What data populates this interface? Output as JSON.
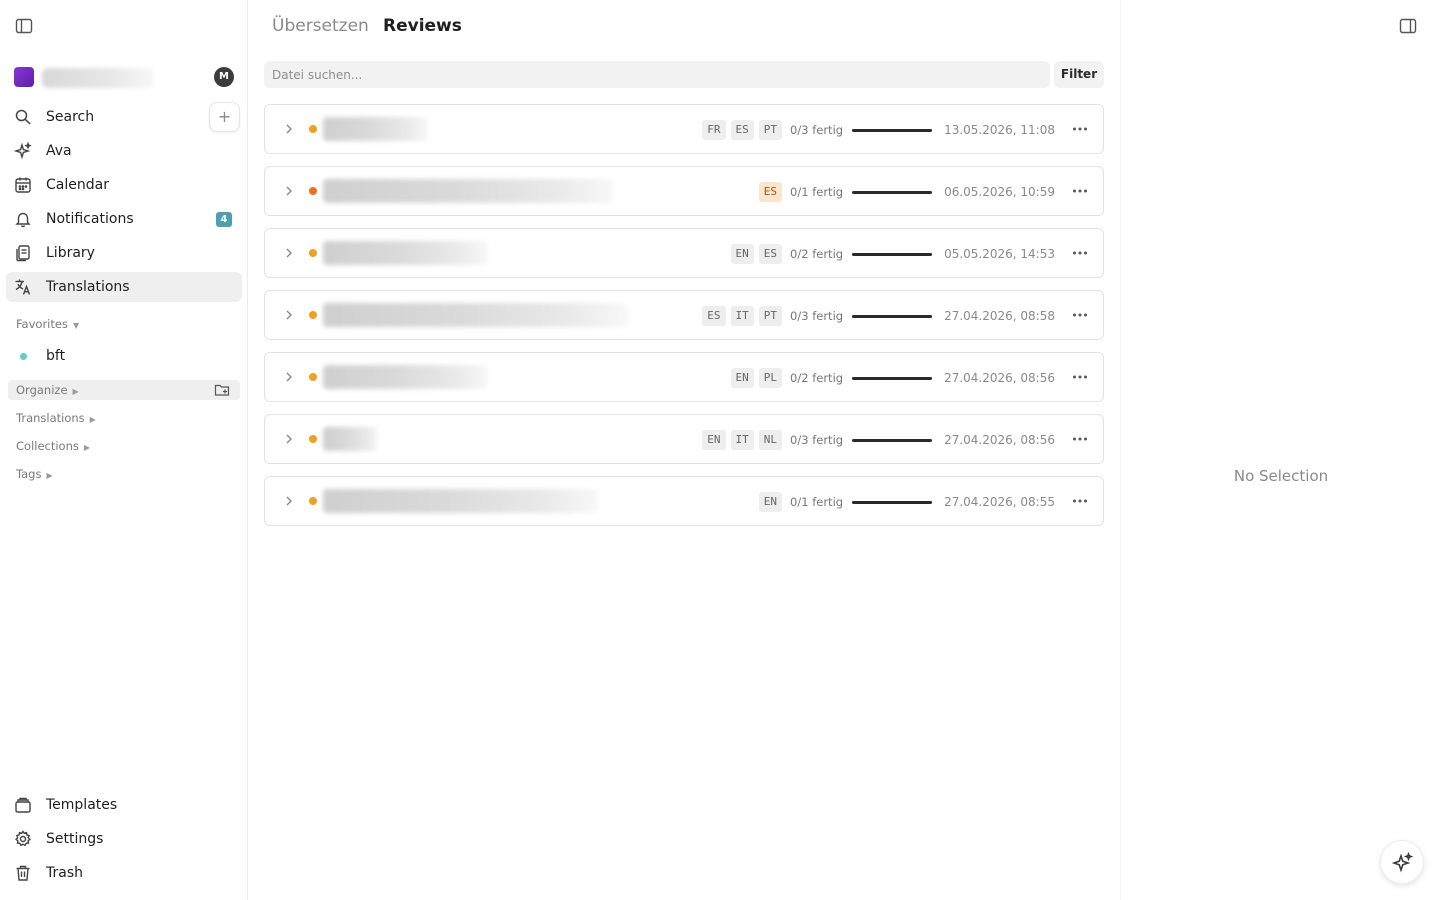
{
  "sidebar": {
    "workspace_avatar": "M",
    "nav": [
      {
        "label": "Search",
        "icon": "search-icon"
      },
      {
        "label": "Ava",
        "icon": "sparkle-icon"
      },
      {
        "label": "Calendar",
        "icon": "calendar-icon"
      },
      {
        "label": "Notifications",
        "icon": "bell-icon",
        "badge": "4"
      },
      {
        "label": "Library",
        "icon": "library-icon"
      },
      {
        "label": "Translations",
        "icon": "translate-icon",
        "active": true
      }
    ],
    "favorites_title": "Favorites",
    "favorites": [
      {
        "label": "bft",
        "color": "#5fcfc1"
      }
    ],
    "sections": [
      "Organize",
      "Translations",
      "Collections",
      "Tags"
    ],
    "bottom": [
      {
        "label": "Templates",
        "icon": "templates-icon"
      },
      {
        "label": "Settings",
        "icon": "gear-icon"
      },
      {
        "label": "Trash",
        "icon": "trash-icon"
      }
    ]
  },
  "header": {
    "tabs": [
      {
        "label": "Übersetzen",
        "active": false
      },
      {
        "label": "Reviews",
        "active": true
      }
    ]
  },
  "search": {
    "placeholder": "Datei suchen...",
    "filter_label": "Filter"
  },
  "rows": [
    {
      "status_color": "#f0a020",
      "langs": [
        "FR",
        "ES",
        "PT"
      ],
      "progress_text": "0/3 fertig",
      "progress": 0,
      "date": "13.05.2026, 11:08"
    },
    {
      "status_color": "#f07020",
      "langs": [
        "ES"
      ],
      "lang_warn": true,
      "progress_text": "0/1 fertig",
      "progress": 0,
      "date": "06.05.2026, 10:59"
    },
    {
      "status_color": "#f0a020",
      "langs": [
        "EN",
        "ES"
      ],
      "progress_text": "0/2 fertig",
      "progress": 0,
      "date": "05.05.2026, 14:53"
    },
    {
      "status_color": "#f0a020",
      "langs": [
        "ES",
        "IT",
        "PT"
      ],
      "progress_text": "0/3 fertig",
      "progress": 0,
      "date": "27.04.2026, 08:58"
    },
    {
      "status_color": "#f0a020",
      "langs": [
        "EN",
        "PL"
      ],
      "progress_text": "0/2 fertig",
      "progress": 0,
      "date": "27.04.2026, 08:56"
    },
    {
      "status_color": "#f0a020",
      "langs": [
        "EN",
        "IT",
        "NL"
      ],
      "progress_text": "0/3 fertig",
      "progress": 0,
      "date": "27.04.2026, 08:56"
    },
    {
      "status_color": "#f0a020",
      "langs": [
        "EN"
      ],
      "progress_text": "0/1 fertig",
      "progress": 0,
      "date": "27.04.2026, 08:55"
    }
  ],
  "right_panel": {
    "empty_text": "No Selection"
  }
}
